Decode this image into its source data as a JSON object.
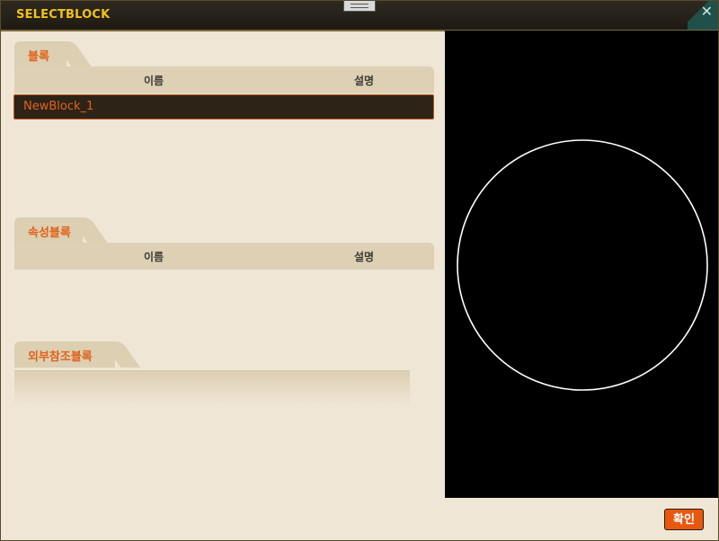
{
  "window": {
    "title": "SELECTBLOCK"
  },
  "sections": {
    "blocks": {
      "tab_label": "블록",
      "columns": {
        "name": "이름",
        "description": "설명"
      },
      "rows": [
        {
          "name": "NewBlock_1",
          "selected": true
        }
      ]
    },
    "attribute_blocks": {
      "tab_label": "속성블록",
      "columns": {
        "name": "이름",
        "description": "설명"
      },
      "rows": []
    },
    "external_reference_blocks": {
      "tab_label": "외부참조블록"
    }
  },
  "preview": {
    "shape": "circle",
    "stroke_color": "#ffffff",
    "background": "#000000"
  },
  "footer": {
    "ok_label": "확인"
  },
  "colors": {
    "accent": "#e0621a",
    "title": "#f2c21a",
    "panel": "#efe6d6"
  }
}
